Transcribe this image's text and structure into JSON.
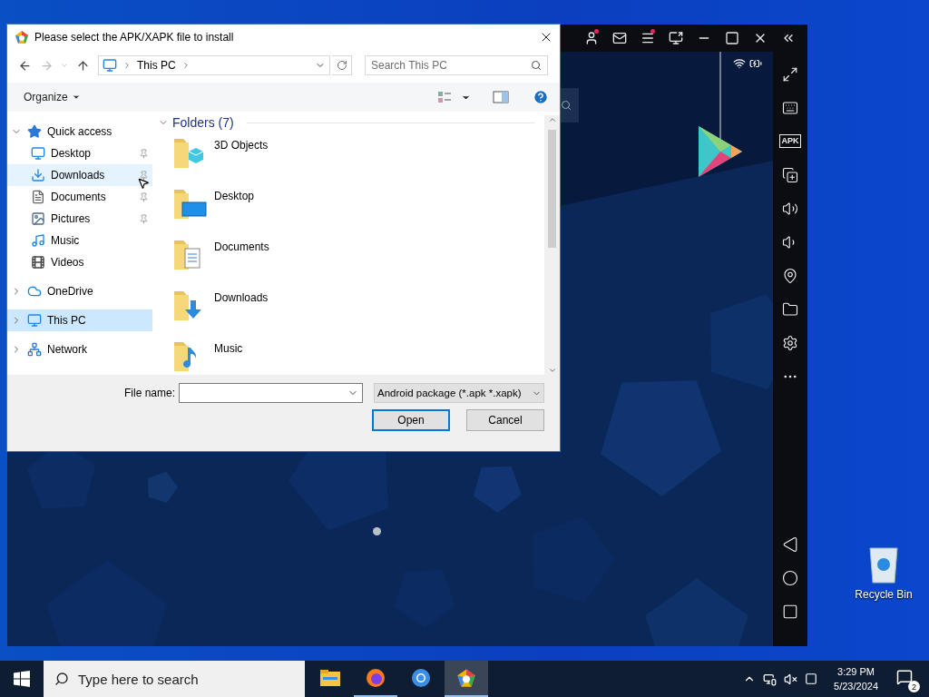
{
  "dialog": {
    "title": "Please select the APK/XAPK file to install",
    "address": {
      "segments": [
        "This PC"
      ]
    },
    "search": {
      "placeholder": "Search This PC"
    },
    "toolbar": {
      "organize": "Organize"
    },
    "nav_pane": [
      {
        "label": "Quick access",
        "kind": "star",
        "expanded": true,
        "selected": false,
        "hovered": false,
        "children": [
          {
            "label": "Desktop",
            "kind": "desktop",
            "pinned": true,
            "selected": false,
            "hovered": false
          },
          {
            "label": "Downloads",
            "kind": "downloads",
            "pinned": true,
            "selected": false,
            "hovered": true
          },
          {
            "label": "Documents",
            "kind": "documents",
            "pinned": true,
            "selected": false,
            "hovered": false
          },
          {
            "label": "Pictures",
            "kind": "pictures",
            "pinned": true,
            "selected": false,
            "hovered": false
          },
          {
            "label": "Music",
            "kind": "music",
            "pinned": false,
            "selected": false,
            "hovered": false
          },
          {
            "label": "Videos",
            "kind": "videos",
            "pinned": false,
            "selected": false,
            "hovered": false
          }
        ]
      },
      {
        "label": "OneDrive",
        "kind": "cloud",
        "expanded": false,
        "selected": false,
        "hovered": false
      },
      {
        "label": "This PC",
        "kind": "pc",
        "expanded": false,
        "selected": true,
        "hovered": false
      },
      {
        "label": "Network",
        "kind": "network",
        "expanded": false,
        "selected": false,
        "hovered": false
      }
    ],
    "content": {
      "group": "Folders (7)",
      "expanded": true,
      "folders": [
        {
          "name": "3D Objects",
          "kind": "cube"
        },
        {
          "name": "Desktop",
          "kind": "desktop"
        },
        {
          "name": "Documents",
          "kind": "documents"
        },
        {
          "name": "Downloads",
          "kind": "downloads"
        },
        {
          "name": "Music",
          "kind": "music"
        }
      ]
    },
    "file_name": {
      "label": "File name:"
    },
    "file_type": "Android package (*.apk *.xapk)",
    "buttons": [
      {
        "label": "Open",
        "default": true
      },
      {
        "label": "Cancel",
        "default": false
      }
    ]
  },
  "emulator": {
    "top_bar": [
      {
        "kind": "avatar",
        "badge": true
      },
      {
        "kind": "mail",
        "badge": false
      },
      {
        "kind": "menu",
        "badge": true
      },
      {
        "kind": "screen",
        "badge": false
      },
      {
        "kind": "minimize",
        "badge": false
      },
      {
        "kind": "maximize",
        "badge": false
      },
      {
        "kind": "close",
        "badge": false
      },
      {
        "kind": "collapse",
        "badge": false
      }
    ],
    "side_tools": [
      {
        "kind": "fullscreen"
      },
      {
        "kind": "keyboard"
      },
      {
        "kind": "apk",
        "label": "APK"
      },
      {
        "kind": "add-window"
      },
      {
        "kind": "volume-up"
      },
      {
        "kind": "volume-down"
      },
      {
        "kind": "location"
      },
      {
        "kind": "folder"
      },
      {
        "kind": "settings"
      },
      {
        "kind": "more"
      }
    ],
    "nav_keys": [
      {
        "kind": "back"
      },
      {
        "kind": "home"
      },
      {
        "kind": "recents"
      }
    ]
  },
  "desktop": {
    "icons": [
      {
        "label": "Recycle Bin"
      }
    ]
  },
  "taskbar": {
    "search": {
      "placeholder": "Type here to search"
    },
    "apps": [
      {
        "kind": "explorer",
        "running": false,
        "selected": false
      },
      {
        "kind": "firefox",
        "running": true,
        "selected": false
      },
      {
        "kind": "chrome",
        "running": false,
        "selected": false
      },
      {
        "kind": "emulator",
        "running": true,
        "selected": true
      }
    ],
    "time": "3:29 PM",
    "date": "5/23/2024",
    "notifications": "2"
  }
}
